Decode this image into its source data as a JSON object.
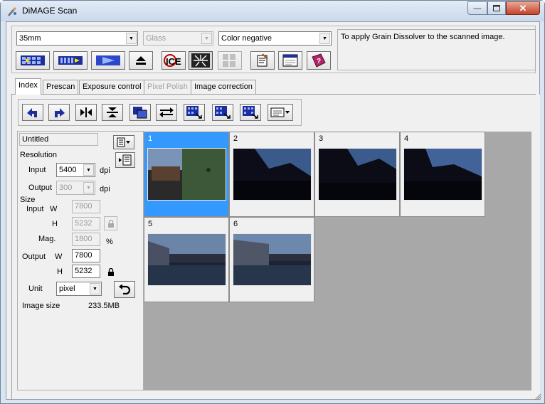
{
  "window": {
    "title": "DiMAGE Scan",
    "minimize_icon": "minimize-icon",
    "maximize_icon": "maximize-icon",
    "close_icon": "close-icon"
  },
  "top_selects": {
    "film_format": "35mm",
    "holder": "Glass",
    "film_type": "Color negative"
  },
  "hint_text": "To apply Grain Dissolver to the scanned image.",
  "toolbar_icons": [
    "index-scan-icon",
    "prescan-icon",
    "scan-icon",
    "eject-icon",
    "ice-icon",
    "grain-dissolver-icon",
    "pixel-polish-icon",
    "preferences-icon",
    "job-icon",
    "help-icon"
  ],
  "tabs": [
    {
      "label": "Index",
      "active": true
    },
    {
      "label": "Prescan",
      "active": false
    },
    {
      "label": "Exposure control",
      "active": false
    },
    {
      "label": "Pixel Polish",
      "active": false,
      "disabled": true
    },
    {
      "label": "Image correction",
      "active": false
    }
  ],
  "index_toolbar_icons": [
    "rotate-left-icon",
    "rotate-right-icon",
    "flip-horizontal-icon",
    "flip-vertical-icon",
    "select-all-icon",
    "swap-icon",
    "batch-scan-icon",
    "batch-scan-2-icon",
    "batch-scan-3-icon",
    "view-options-icon"
  ],
  "settings": {
    "job_name": "Untitled",
    "resolution_label": "Resolution",
    "input_label": "Input",
    "input_dpi": "5400",
    "dpi_unit": "dpi",
    "output_label": "Output",
    "output_dpi": "300",
    "size_label": "Size",
    "size_input_label": "Input",
    "w_label": "W",
    "h_label": "H",
    "input_w": "7800",
    "input_h": "5232",
    "mag_label": "Mag.",
    "mag_value": "1800",
    "percent": "%",
    "size_output_label": "Output",
    "output_w": "7800",
    "output_h": "5232",
    "unit_label": "Unit",
    "unit_value": "pixel",
    "image_size_label": "Image size",
    "image_size_value": "233.5MB"
  },
  "frames": [
    {
      "num": "1",
      "selected": true
    },
    {
      "num": "2",
      "selected": false
    },
    {
      "num": "3",
      "selected": false
    },
    {
      "num": "4",
      "selected": false
    },
    {
      "num": "5",
      "selected": false
    },
    {
      "num": "6",
      "selected": false
    }
  ],
  "colors": {
    "selection": "#3399ff",
    "thumb_area": "#a8a8a8"
  }
}
